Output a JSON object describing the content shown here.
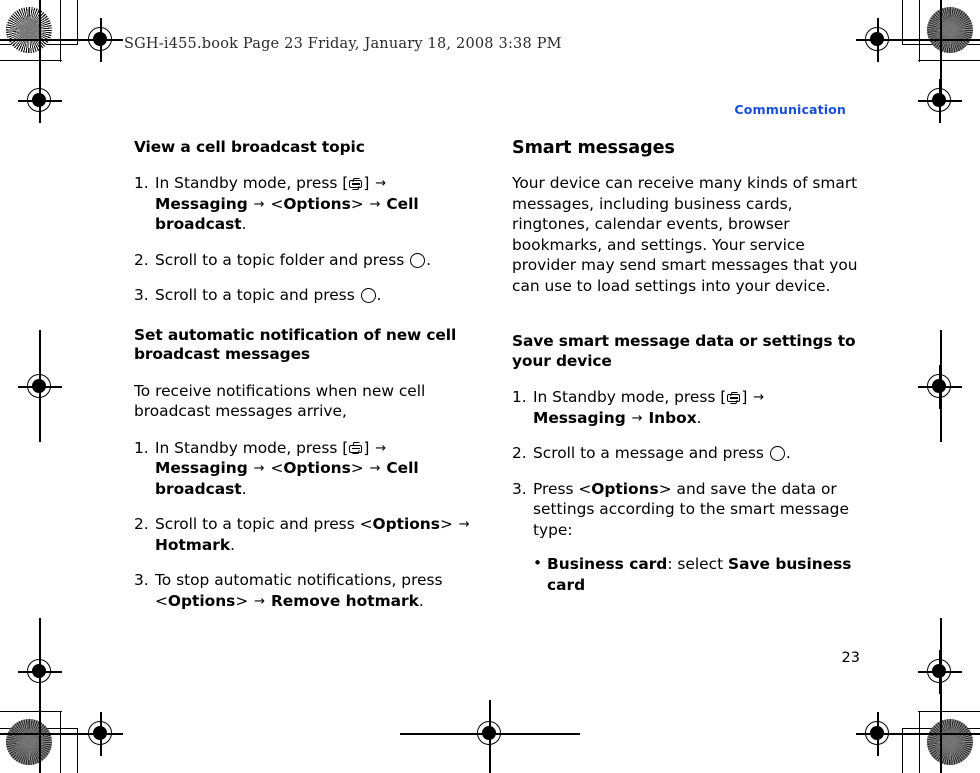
{
  "document": {
    "book_header": "SGH-i455.book  Page 23  Friday, January 18, 2008  3:38 PM",
    "running_head": "Communication",
    "page_number": "23",
    "accent_color": "#1a4fd4"
  },
  "left_column": {
    "section_1": {
      "heading": "View a cell broadcast topic",
      "steps": [
        {
          "num": "1.",
          "parts": [
            {
              "t": "In Standby mode, press [",
              "b": false
            },
            {
              "t": "KEY",
              "b": false
            },
            {
              "t": "] ",
              "b": false
            },
            {
              "t": "ARROW",
              "b": false
            },
            {
              "t": " ",
              "b": false
            },
            {
              "t": "Messaging",
              "b": true
            },
            {
              "t": " ",
              "b": false
            },
            {
              "t": "ARROW",
              "b": false
            },
            {
              "t": " <",
              "b": false
            },
            {
              "t": "Options",
              "b": true
            },
            {
              "t": "> ",
              "b": false
            },
            {
              "t": "ARROW",
              "b": false
            },
            {
              "t": " ",
              "b": false
            },
            {
              "t": "Cell broadcast",
              "b": true
            },
            {
              "t": ".",
              "b": false
            }
          ]
        },
        {
          "num": "2.",
          "parts": [
            {
              "t": "Scroll to a topic folder and press ",
              "b": false
            },
            {
              "t": "OKKEY",
              "b": false
            },
            {
              "t": ".",
              "b": false
            }
          ]
        },
        {
          "num": "3.",
          "parts": [
            {
              "t": "Scroll to a topic and press ",
              "b": false
            },
            {
              "t": "OKKEY",
              "b": false
            },
            {
              "t": ".",
              "b": false
            }
          ]
        }
      ]
    },
    "section_2": {
      "heading": "Set automatic notification of new cell broadcast messages",
      "intro": "To receive notifications when new cell broadcast messages arrive,",
      "steps": [
        {
          "num": "1.",
          "parts": [
            {
              "t": "In Standby mode, press [",
              "b": false
            },
            {
              "t": "KEY",
              "b": false
            },
            {
              "t": "] ",
              "b": false
            },
            {
              "t": "ARROW",
              "b": false
            },
            {
              "t": " ",
              "b": false
            },
            {
              "t": "Messaging",
              "b": true
            },
            {
              "t": " ",
              "b": false
            },
            {
              "t": "ARROW",
              "b": false
            },
            {
              "t": " <",
              "b": false
            },
            {
              "t": "Options",
              "b": true
            },
            {
              "t": "> ",
              "b": false
            },
            {
              "t": "ARROW",
              "b": false
            },
            {
              "t": " ",
              "b": false
            },
            {
              "t": "Cell broadcast",
              "b": true
            },
            {
              "t": ".",
              "b": false
            }
          ]
        },
        {
          "num": "2.",
          "parts": [
            {
              "t": "Scroll to a topic and press <",
              "b": false
            },
            {
              "t": "Options",
              "b": true
            },
            {
              "t": "> ",
              "b": false
            },
            {
              "t": "ARROW",
              "b": false
            },
            {
              "t": " ",
              "b": false
            },
            {
              "t": "Hotmark",
              "b": true
            },
            {
              "t": ".",
              "b": false
            }
          ]
        },
        {
          "num": "3.",
          "parts": [
            {
              "t": "To stop automatic notifications, press <",
              "b": false
            },
            {
              "t": "Options",
              "b": true
            },
            {
              "t": "> ",
              "b": false
            },
            {
              "t": "ARROW",
              "b": false
            },
            {
              "t": " ",
              "b": false
            },
            {
              "t": "Remove hotmark",
              "b": true
            },
            {
              "t": ".",
              "b": false
            }
          ]
        }
      ]
    }
  },
  "right_column": {
    "section_1": {
      "heading": "Smart messages",
      "body": "Your device can receive many kinds of smart messages, including business cards, ringtones, calendar events, browser bookmarks, and settings. Your service provider may send smart messages that you can use to load settings into your device."
    },
    "section_2": {
      "heading": "Save smart message data or settings to your device",
      "steps": [
        {
          "num": "1.",
          "parts": [
            {
              "t": "In Standby mode, press [",
              "b": false
            },
            {
              "t": "KEY",
              "b": false
            },
            {
              "t": "] ",
              "b": false
            },
            {
              "t": "ARROW",
              "b": false
            },
            {
              "t": " ",
              "b": false
            },
            {
              "t": "Messaging",
              "b": true
            },
            {
              "t": " ",
              "b": false
            },
            {
              "t": "ARROW",
              "b": false
            },
            {
              "t": " ",
              "b": false
            },
            {
              "t": "Inbox",
              "b": true
            },
            {
              "t": ".",
              "b": false
            }
          ]
        },
        {
          "num": "2.",
          "parts": [
            {
              "t": "Scroll to a message and press ",
              "b": false
            },
            {
              "t": "OKKEY",
              "b": false
            },
            {
              "t": ".",
              "b": false
            }
          ]
        },
        {
          "num": "3.",
          "parts": [
            {
              "t": "Press <",
              "b": false
            },
            {
              "t": "Options",
              "b": true
            },
            {
              "t": "> and save the data or settings according to the smart message type:",
              "b": false
            }
          ],
          "bullets": [
            {
              "bullet": "•",
              "parts": [
                {
                  "t": "Business card",
                  "b": true
                },
                {
                  "t": ": select ",
                  "b": false
                },
                {
                  "t": "Save business card",
                  "b": true
                }
              ]
            }
          ]
        }
      ]
    }
  }
}
